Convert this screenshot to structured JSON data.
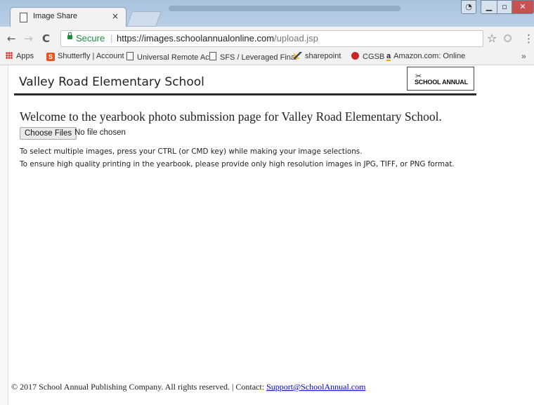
{
  "browser": {
    "tab": {
      "title": "Image Share",
      "close": "×"
    },
    "address": {
      "secure_label": "Secure",
      "separator": "|",
      "url_base": "https://images.schoolannualonline.com",
      "url_path": "/upload.jsp"
    },
    "nav": {
      "back": "←",
      "forward": "→",
      "reload": "C"
    },
    "bookmarks": [
      {
        "label": "Apps",
        "icon": "apps-grid-icon"
      },
      {
        "label": "Shutterfly | Account i",
        "icon": "shutterfly-icon"
      },
      {
        "label": "Universal Remote Acc",
        "icon": "document-icon"
      },
      {
        "label": "SFS / Leveraged Finar",
        "icon": "document-icon"
      },
      {
        "label": "sharepoint",
        "icon": "sharepoint-icon"
      },
      {
        "label": "CGSB",
        "icon": "cgsb-icon"
      },
      {
        "label": "Amazon.com: Online",
        "icon": "amazon-icon"
      }
    ],
    "more": "»"
  },
  "page": {
    "school_name": "Valley Road Elementary School",
    "logo_text": "SCHOOL ANNUAL",
    "welcome": "Welcome to the yearbook photo submission page for Valley Road Elementary School.",
    "file_input": {
      "button_label": "Choose Files",
      "status": "No file chosen"
    },
    "instructions": [
      "To select multiple images, press your CTRL (or CMD key) while making your image selections.",
      "To ensure high quality printing in the yearbook, please provide only high resolution images in JPG, TIFF, or PNG format."
    ],
    "footer": {
      "text": "© 2017 School Annual Publishing Company. All rights reserved. | Contact: ",
      "link": "Support@SchoolAnnual.com"
    }
  },
  "colors": {
    "secure_green": "#1e8e3e",
    "link_blue": "#0000cc",
    "window_close_red": "#c75050"
  }
}
